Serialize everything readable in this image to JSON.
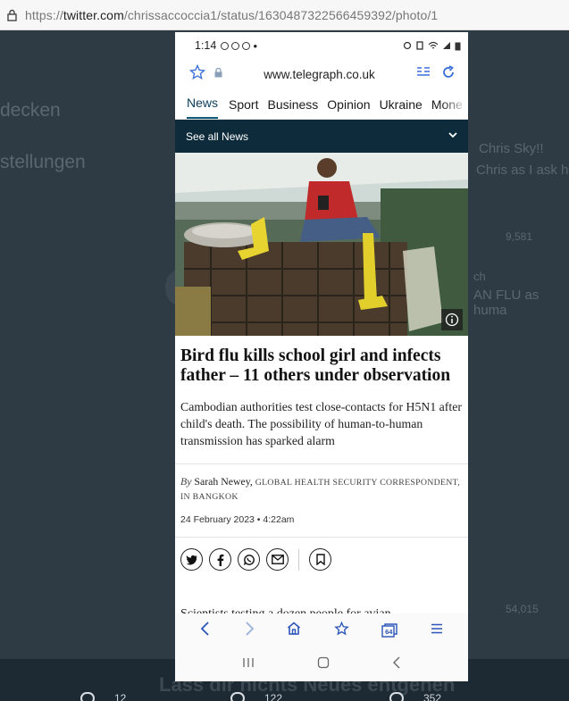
{
  "browser": {
    "url_prefix": "https://",
    "url_host": "twitter.com",
    "url_path": "/chrissaccoccia1/status/1630487322566459392/photo/1"
  },
  "backdrop": {
    "left_texts": [
      "decken",
      "stellungen"
    ],
    "right_texts": [
      "Chris Sky!!",
      "Chris as I ask h",
      "9,581",
      "ch",
      "AN FLU as huma",
      "54,015"
    ],
    "bottom_cta": "Lass dir nichts Neues entgehen",
    "stats": [
      "12",
      "122",
      "352"
    ]
  },
  "phone": {
    "status": {
      "time": "1:14"
    },
    "address": {
      "host": "www.telegraph.co.uk"
    },
    "tabs": [
      {
        "label": "News",
        "active": true
      },
      {
        "label": "Sport"
      },
      {
        "label": "Business"
      },
      {
        "label": "Opinion"
      },
      {
        "label": "Ukraine"
      },
      {
        "label": "Mone"
      }
    ],
    "section_bar": {
      "label": "See all News"
    },
    "article": {
      "headline": "Bird flu kills school girl and infects father – 11 others under observation",
      "standfirst": "Cambodian authorities test close-contacts for H5N1 after child's death. The possibility of human-to-human transmission has sparked alarm",
      "byline_by": "By",
      "author": "Sarah Newey,",
      "role": "GLOBAL HEALTH SECURITY CORRESPONDENT, IN BANGKOK",
      "date": "24 February 2023 • 4:22am",
      "teaser": "Scientists testing a dozen people for avian"
    },
    "nav": {
      "tab_count": "64"
    }
  },
  "colors": {
    "section_bar": "#0d2b3b",
    "active_tab": "#0c3c5a",
    "backdrop": "#2e3a44"
  }
}
